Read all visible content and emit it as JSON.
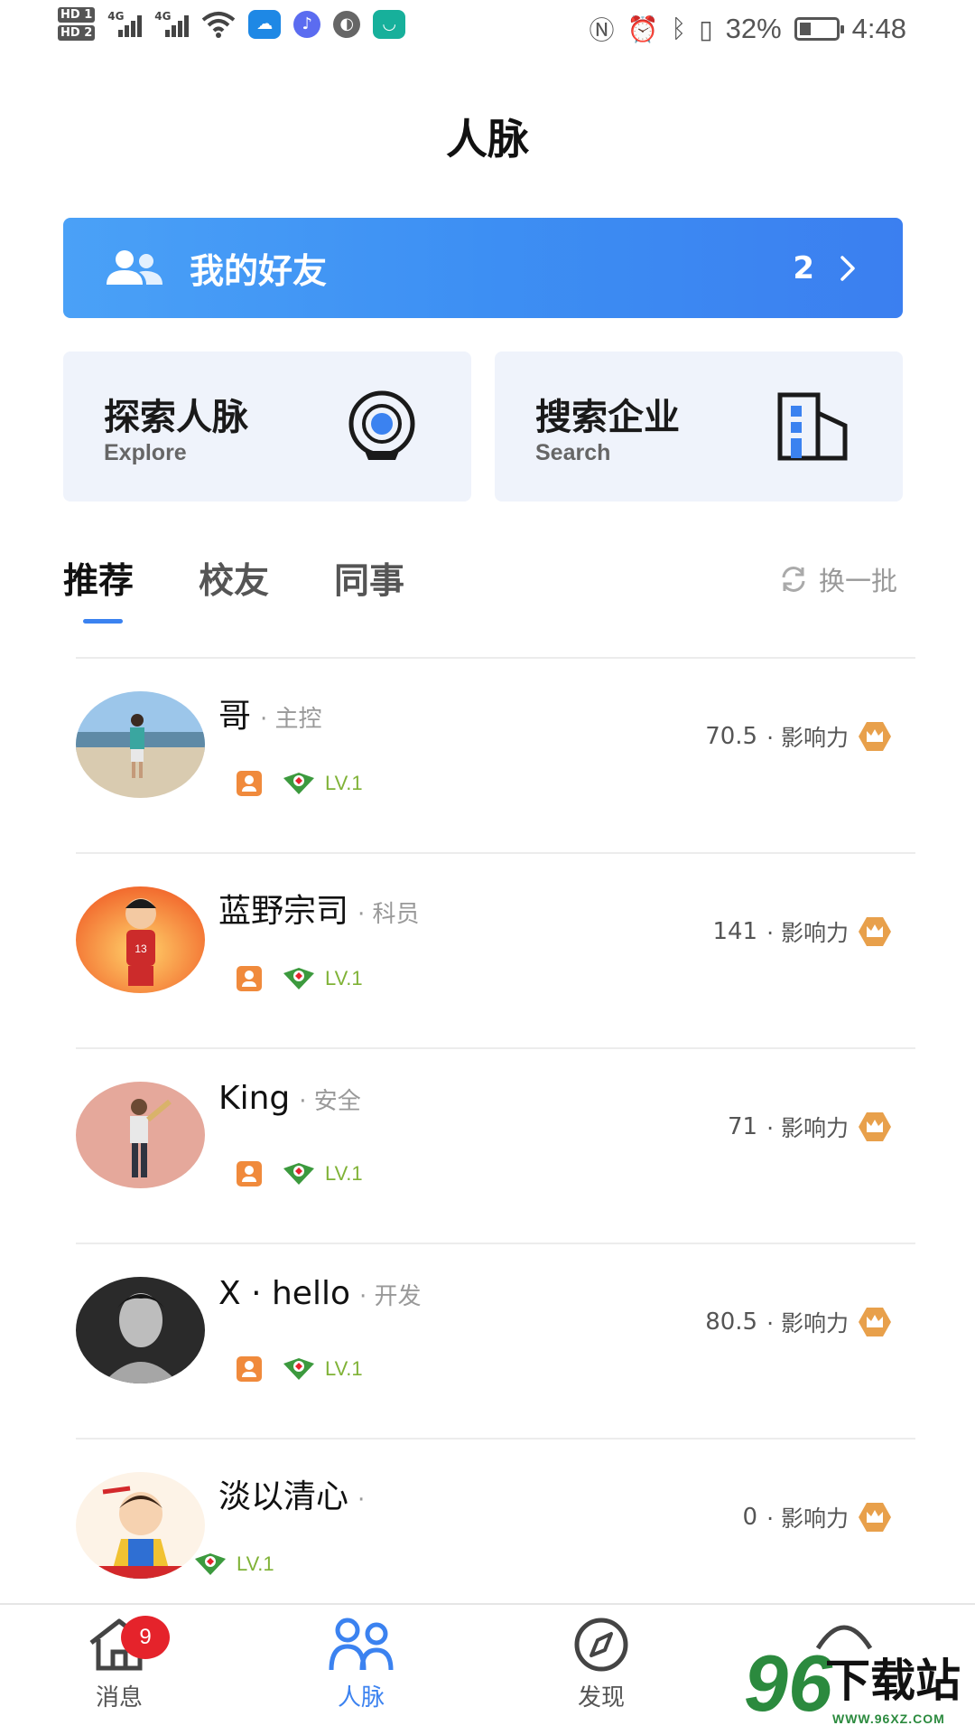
{
  "status_bar": {
    "hd1": "HD 1",
    "hd2": "HD 2",
    "network": "4G",
    "battery": "32%",
    "battery_level": 0.32,
    "time": "4:48"
  },
  "header": {
    "title": "人脉"
  },
  "friends_banner": {
    "label": "我的好友",
    "count": "2",
    "icon": "people-icon"
  },
  "feature_cards": [
    {
      "title": "探索人脉",
      "subtitle": "Explore",
      "icon": "radar-icon"
    },
    {
      "title": "搜索企业",
      "subtitle": "Search",
      "icon": "building-icon"
    }
  ],
  "tabs": [
    {
      "label": "推荐",
      "active": true
    },
    {
      "label": "校友",
      "active": false
    },
    {
      "label": "同事",
      "active": false
    }
  ],
  "refresh_label": "换一批",
  "people": [
    {
      "name": "哥",
      "role": "· 主控",
      "level": "LV.1",
      "score": "70.5",
      "influence_label": "· 影响力",
      "has_id_badge": true
    },
    {
      "name": "蓝野宗司",
      "role": "· 科员",
      "level": "LV.1",
      "score": "141",
      "influence_label": "· 影响力",
      "has_id_badge": true
    },
    {
      "name": "King",
      "role": "· 安全",
      "level": "LV.1",
      "score": "71",
      "influence_label": "· 影响力",
      "has_id_badge": true
    },
    {
      "name": "X · hello",
      "role": "· 开发",
      "level": "LV.1",
      "score": "80.5",
      "influence_label": "· 影响力",
      "has_id_badge": true
    },
    {
      "name": "淡以清心",
      "role": "·",
      "level": "LV.1",
      "score": "0",
      "influence_label": "· 影响力",
      "has_id_badge": false
    }
  ],
  "bottom_nav": [
    {
      "label": "消息",
      "icon": "home-icon",
      "badge": "9",
      "active": false
    },
    {
      "label": "人脉",
      "icon": "contacts-icon",
      "active": true
    },
    {
      "label": "发现",
      "icon": "compass-icon",
      "active": false
    }
  ],
  "watermark": {
    "number": "96",
    "text": "下载站",
    "url": "WWW.96XZ.COM"
  },
  "colors": {
    "accent": "#3b82f0",
    "banner_start": "#4aa1f7",
    "banner_end": "#3b7ff0",
    "level_green": "#7fb236",
    "crown_orange": "#e8a04b",
    "badge_red": "#e5232b"
  }
}
